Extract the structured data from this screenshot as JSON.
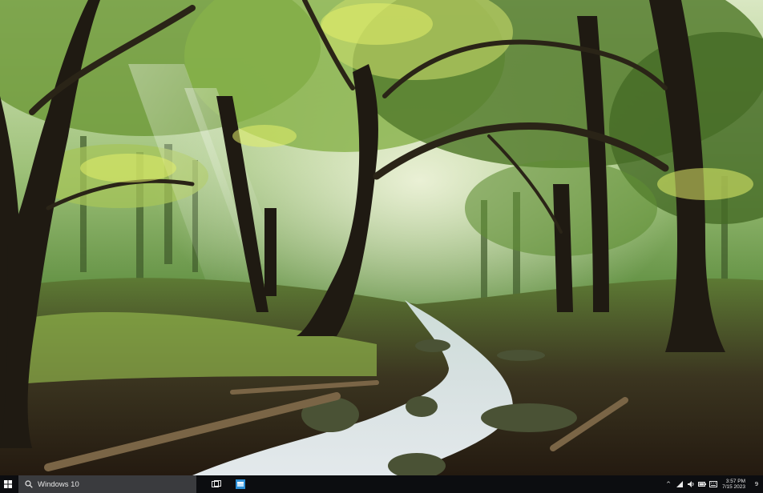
{
  "desktop": {
    "wallpaper": "forest-stream-wallpaper"
  },
  "taskbar": {
    "start_icon": "windows-logo-icon",
    "search": {
      "icon": "search-icon",
      "placeholder": "Windows 10"
    },
    "task_view_icon": "task-view-icon",
    "pinned_app_icon": "app-icon",
    "tray": {
      "chevron": "^",
      "clock_time": "3:57 PM",
      "clock_date": "7/15 2023",
      "notifications": "9"
    },
    "colors": {
      "bar": "#0c0d10",
      "search": "#3a3b3e",
      "accent": "#2d8fd6"
    }
  }
}
